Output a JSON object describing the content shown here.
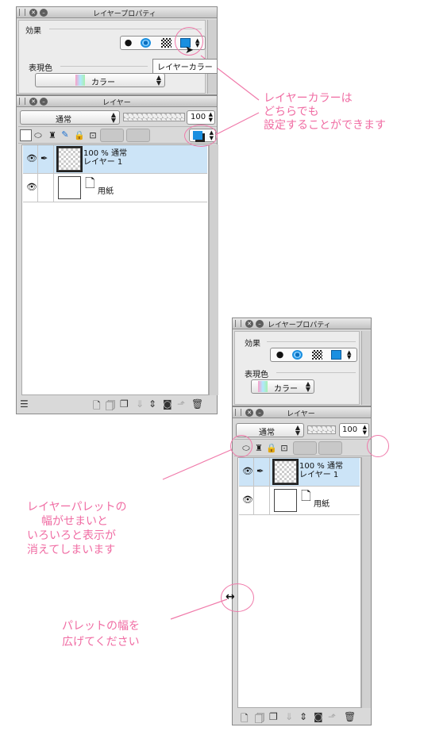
{
  "panel_a": {
    "title": "レイヤープロパティ",
    "section_label": "効果",
    "expression_label": "表現色",
    "expression_value": "カラー",
    "tooltip": "レイヤーカラー"
  },
  "layer_a": {
    "title": "レイヤー",
    "blend_mode": "通常",
    "opacity": "100",
    "layers": [
      {
        "line1": "100 % 通常",
        "line2": "レイヤー 1"
      },
      {
        "line1": "",
        "line2": "用紙"
      }
    ]
  },
  "panel_b": {
    "title": "レイヤープロパティ",
    "section_label": "効果",
    "expression_label": "表現色",
    "expression_value": "カラー"
  },
  "layer_b": {
    "title": "レイヤー",
    "blend_mode": "通常",
    "opacity": "100",
    "layers": [
      {
        "line1": "100 % 通常",
        "line2": "レイヤー 1"
      },
      {
        "line1": "",
        "line2": "用紙"
      }
    ]
  },
  "annotations": {
    "top": [
      "レイヤーカラーは",
      "どちらでも",
      "設定することができます"
    ],
    "middle": [
      "レイヤーパレットの",
      "幅がせまいと",
      "いろいろと表示が",
      "消えてしまいます"
    ],
    "bottom": [
      "パレットの幅を",
      "広げてください"
    ]
  },
  "colors": {
    "annotation": "#f06ca3",
    "layer_color": "#1a8fe0",
    "selected_row": "#cce4f7"
  }
}
